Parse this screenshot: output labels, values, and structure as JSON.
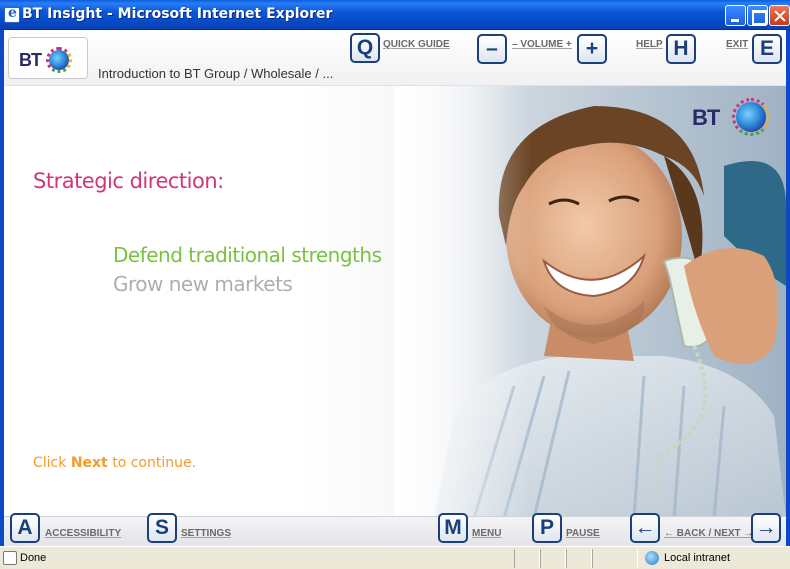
{
  "window": {
    "title": "BT Insight - Microsoft Internet Explorer"
  },
  "header": {
    "logo_text": "BT",
    "breadcrumb": "Introduction to BT Group / Wholesale / ..."
  },
  "toolbar": {
    "quick_guide": {
      "key": "Q",
      "label": "QUICK GUIDE"
    },
    "volume_down": {
      "key": "–"
    },
    "volume_label": "– VOLUME +",
    "volume_up": {
      "key": "+"
    },
    "help": {
      "key": "H",
      "label": "HELP"
    },
    "exit": {
      "key": "E",
      "label": "EXIT"
    }
  },
  "slide": {
    "logo_text": "BT",
    "heading": "Strategic direction:",
    "bullets": [
      "Defend traditional strengths",
      "Grow new markets"
    ],
    "cta_prefix": "Click ",
    "cta_bold": "Next",
    "cta_suffix": " to continue."
  },
  "footer": {
    "accessibility": {
      "key": "A",
      "label": "ACCESSIBILITY"
    },
    "settings": {
      "key": "S",
      "label": "SETTINGS"
    },
    "menu": {
      "key": "M",
      "label": "MENU"
    },
    "pause": {
      "key": "P",
      "label": "PAUSE"
    },
    "back": {
      "key": "←"
    },
    "back_next_label": "← BACK / NEXT →",
    "next": {
      "key": "→"
    }
  },
  "statusbar": {
    "status": "Done",
    "zone": "Local intranet"
  },
  "colors": {
    "heading": "#d43479",
    "bullet_active": "#7ac143",
    "bullet_inactive": "#aeaeae",
    "cta": "#f39a2a",
    "key_border": "#1a3f7a"
  }
}
